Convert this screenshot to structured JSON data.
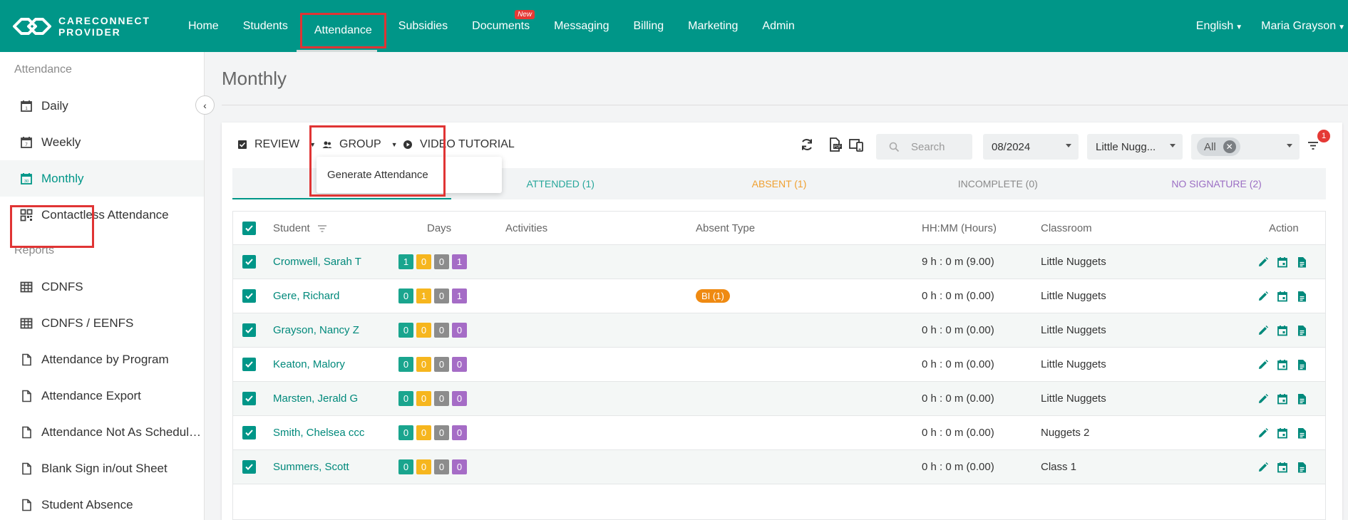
{
  "app": {
    "logo_line1": "CARECONNECT",
    "logo_line2": "PROVIDER"
  },
  "nav": {
    "items": [
      "Home",
      "Students",
      "Attendance",
      "Subsidies",
      "Documents",
      "Messaging",
      "Billing",
      "Marketing",
      "Admin"
    ],
    "active": "Attendance",
    "new_badge": "New",
    "language": "English",
    "user": "Maria Grayson"
  },
  "sidebar": {
    "section_attendance": "Attendance",
    "attendance_items": [
      "Daily",
      "Weekly",
      "Monthly",
      "Contactless Attendance"
    ],
    "section_reports": "Reports",
    "report_items": [
      "CDNFS",
      "CDNFS / EENFS",
      "Attendance by Program",
      "Attendance Export",
      "Attendance Not As Schedul…",
      "Blank Sign in/out Sheet",
      "Student Absence"
    ]
  },
  "page": {
    "title": "Monthly"
  },
  "toolbar": {
    "review_label": "REVIEW",
    "group_label": "GROUP",
    "video_label": "VIDEO TUTORIAL",
    "group_menu_item": "Generate Attendance",
    "search_placeholder": "Search",
    "month_value": "08/2024",
    "classroom_value": "Little Nugg...",
    "status_chip": "All",
    "filter_count": "1"
  },
  "tabs": {
    "attended": "ATTENDED (1)",
    "absent": "ABSENT (1)",
    "incomplete": "INCOMPLETE (0)",
    "no_signature": "NO SIGNATURE (2)"
  },
  "table": {
    "headers": {
      "student": "Student",
      "days": "Days",
      "activities": "Activities",
      "absent_type": "Absent Type",
      "hours": "HH:MM (Hours)",
      "classroom": "Classroom",
      "action": "Action"
    },
    "rows": [
      {
        "student": "Cromwell, Sarah T",
        "days": [
          "1",
          "0",
          "0",
          "1"
        ],
        "absent_type": "",
        "hours": "9 h : 0 m (9.00)",
        "classroom": "Little Nuggets"
      },
      {
        "student": "Gere, Richard",
        "days": [
          "0",
          "1",
          "0",
          "1"
        ],
        "absent_type": "BI (1)",
        "hours": "0 h : 0 m (0.00)",
        "classroom": "Little Nuggets"
      },
      {
        "student": "Grayson, Nancy Z",
        "days": [
          "0",
          "0",
          "0",
          "0"
        ],
        "absent_type": "",
        "hours": "0 h : 0 m (0.00)",
        "classroom": "Little Nuggets"
      },
      {
        "student": "Keaton, Malory",
        "days": [
          "0",
          "0",
          "0",
          "0"
        ],
        "absent_type": "",
        "hours": "0 h : 0 m (0.00)",
        "classroom": "Little Nuggets"
      },
      {
        "student": "Marsten, Jerald G",
        "days": [
          "0",
          "0",
          "0",
          "0"
        ],
        "absent_type": "",
        "hours": "0 h : 0 m (0.00)",
        "classroom": "Little Nuggets"
      },
      {
        "student": "Smith, Chelsea ccc",
        "days": [
          "0",
          "0",
          "0",
          "0"
        ],
        "absent_type": "",
        "hours": "0 h : 0 m (0.00)",
        "classroom": "Nuggets 2"
      },
      {
        "student": "Summers, Scott",
        "days": [
          "0",
          "0",
          "0",
          "0"
        ],
        "absent_type": "",
        "hours": "0 h : 0 m (0.00)",
        "classroom": "Class 1"
      }
    ]
  },
  "colors": {
    "brand": "#009688",
    "attended": "#1aa58e",
    "absent": "#f6b61e",
    "incomplete": "#8c8c8c",
    "no_signature": "#a56cc6",
    "highlight_box": "#e03434"
  }
}
